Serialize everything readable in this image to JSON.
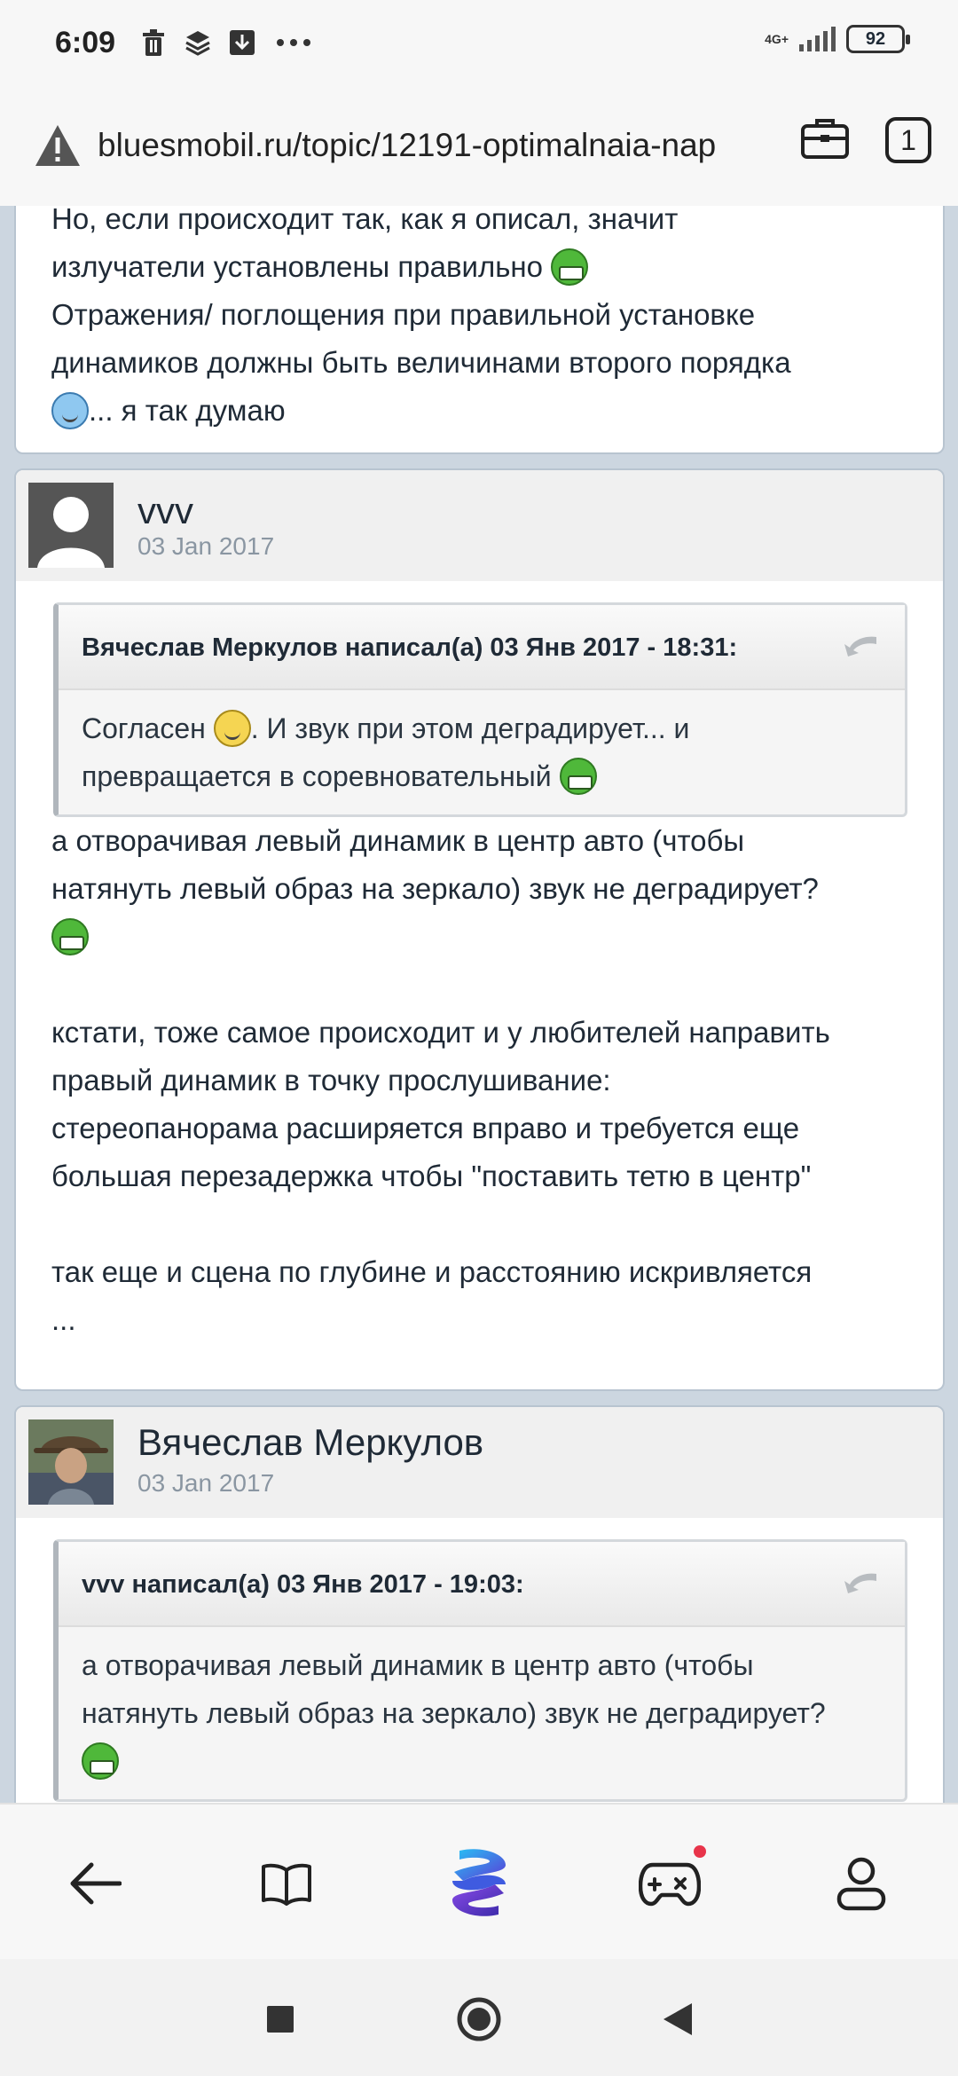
{
  "status_bar": {
    "time": "6:09",
    "network": "4G+",
    "battery": "92"
  },
  "browser": {
    "url": "bluesmobil.ru/topic/12191-optimalnaia-nap",
    "tab_count": "1"
  },
  "posts": [
    {
      "lines": [
        "Но, если происходит так, как я описал, значит",
        "излучатели установлены правильно",
        "Отражения/ поглощения при правильной установке",
        "динамиков должны быть величинами второго порядка",
        "... я так думаю"
      ]
    },
    {
      "author": "vvv",
      "date": "03 Jan 2017",
      "quote": {
        "header": "Вячеслав Меркулов написал(а) 03 Янв 2017 - 18:31:",
        "line1_a": "Согласен",
        "line1_b": ". И звук при этом деградирует... и",
        "line2": "превращается в соревновательный"
      },
      "body": [
        "а отворачивая левый динамик в центр авто (чтобы",
        "натянуть левый образ на зеркало) звук не деградирует?",
        "кстати, тоже самое происходит и у любителей направить",
        "правый динамик в точку прослушивание:",
        "стереопанорама расширяется вправо и требуется еще",
        "большая перезадержка чтобы \"поставить тетю в центр\"",
        "так еще и сцена по глубине и расстоянию искривляется",
        "..."
      ]
    },
    {
      "author": "Вячеслав Меркулов",
      "date": "03 Jan 2017",
      "quote": {
        "header": "vvv написал(а) 03 Янв 2017 - 19:03:",
        "line1": "а отворачивая левый динамик в центр авто (чтобы",
        "line2": "натянуть левый образ на зеркало) звук не деградирует?"
      }
    }
  ],
  "icons": {
    "status": [
      "trash-icon",
      "layers-icon",
      "download-icon",
      "more-icon"
    ],
    "url": [
      "warning-icon",
      "briefcase-icon"
    ],
    "nav": [
      "back-arrow-icon",
      "book-icon",
      "browser-logo-icon",
      "gamepad-icon",
      "profile-icon"
    ],
    "system": [
      "recents-icon",
      "home-icon",
      "back-icon"
    ]
  }
}
